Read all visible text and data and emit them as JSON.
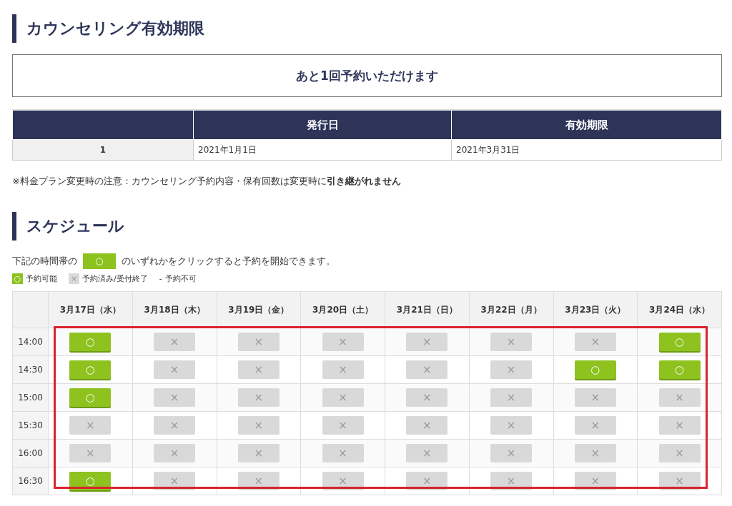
{
  "validity_heading": "カウンセリング有効期限",
  "remaining_notice": "あと1回予約いただけます",
  "validity_table": {
    "columns": [
      "",
      "発行日",
      "有効期限"
    ],
    "rows": [
      [
        "1",
        "2021年1月1日",
        "2021年3月31日"
      ]
    ]
  },
  "plan_note": "※料金プラン変更時の注意：カウンセリング予約内容・保有回数は変更時に**引き継がれません**",
  "schedule_heading": "スケジュール",
  "instruction": {
    "before": "下記の時間帯の",
    "button": "○",
    "after": "のいずれかをクリックすると予約を開始できます。"
  },
  "legend": [
    {
      "kind": "open",
      "symbol": "○",
      "label": "予約可能"
    },
    {
      "kind": "booked",
      "symbol": "×",
      "label": "予約済み/受付終了"
    },
    {
      "kind": "none",
      "symbol": "-",
      "label": "予約不可"
    }
  ],
  "schedule": {
    "days": [
      "3月17日（水）",
      "3月18日（木）",
      "3月19日（金）",
      "3月20日（土）",
      "3月21日（日）",
      "3月22日（月）",
      "3月23日（火）",
      "3月24日（水）"
    ],
    "highlight_frame": true,
    "rows": [
      {
        "time": "14:00",
        "slots": [
          {
            "kind": "open",
            "symbol": "○"
          },
          {
            "kind": "booked",
            "symbol": "×"
          },
          {
            "kind": "booked",
            "symbol": "×"
          },
          {
            "kind": "booked",
            "symbol": "×"
          },
          {
            "kind": "booked",
            "symbol": "×"
          },
          {
            "kind": "booked",
            "symbol": "×"
          },
          {
            "kind": "booked",
            "symbol": "×"
          },
          {
            "kind": "open",
            "symbol": "○"
          }
        ]
      },
      {
        "time": "14:30",
        "slots": [
          {
            "kind": "open",
            "symbol": "○"
          },
          {
            "kind": "booked",
            "symbol": "×"
          },
          {
            "kind": "booked",
            "symbol": "×"
          },
          {
            "kind": "booked",
            "symbol": "×"
          },
          {
            "kind": "booked",
            "symbol": "×"
          },
          {
            "kind": "booked",
            "symbol": "×"
          },
          {
            "kind": "open",
            "symbol": "○"
          },
          {
            "kind": "open",
            "symbol": "○"
          }
        ]
      },
      {
        "time": "15:00",
        "slots": [
          {
            "kind": "open",
            "symbol": "○"
          },
          {
            "kind": "booked",
            "symbol": "×"
          },
          {
            "kind": "booked",
            "symbol": "×"
          },
          {
            "kind": "booked",
            "symbol": "×"
          },
          {
            "kind": "booked",
            "symbol": "×"
          },
          {
            "kind": "booked",
            "symbol": "×"
          },
          {
            "kind": "booked",
            "symbol": "×"
          },
          {
            "kind": "booked",
            "symbol": "×"
          }
        ]
      },
      {
        "time": "15:30",
        "slots": [
          {
            "kind": "booked",
            "symbol": "×"
          },
          {
            "kind": "booked",
            "symbol": "×"
          },
          {
            "kind": "booked",
            "symbol": "×"
          },
          {
            "kind": "booked",
            "symbol": "×"
          },
          {
            "kind": "booked",
            "symbol": "×"
          },
          {
            "kind": "booked",
            "symbol": "×"
          },
          {
            "kind": "booked",
            "symbol": "×"
          },
          {
            "kind": "booked",
            "symbol": "×"
          }
        ]
      },
      {
        "time": "16:00",
        "slots": [
          {
            "kind": "booked",
            "symbol": "×"
          },
          {
            "kind": "booked",
            "symbol": "×"
          },
          {
            "kind": "booked",
            "symbol": "×"
          },
          {
            "kind": "booked",
            "symbol": "×"
          },
          {
            "kind": "booked",
            "symbol": "×"
          },
          {
            "kind": "booked",
            "symbol": "×"
          },
          {
            "kind": "booked",
            "symbol": "×"
          },
          {
            "kind": "booked",
            "symbol": "×"
          }
        ]
      },
      {
        "time": "16:30",
        "slots": [
          {
            "kind": "open",
            "symbol": "○"
          },
          {
            "kind": "booked",
            "symbol": "×"
          },
          {
            "kind": "booked",
            "symbol": "×"
          },
          {
            "kind": "booked",
            "symbol": "×"
          },
          {
            "kind": "booked",
            "symbol": "×"
          },
          {
            "kind": "booked",
            "symbol": "×"
          },
          {
            "kind": "booked",
            "symbol": "×"
          },
          {
            "kind": "booked",
            "symbol": "×"
          }
        ]
      }
    ]
  }
}
